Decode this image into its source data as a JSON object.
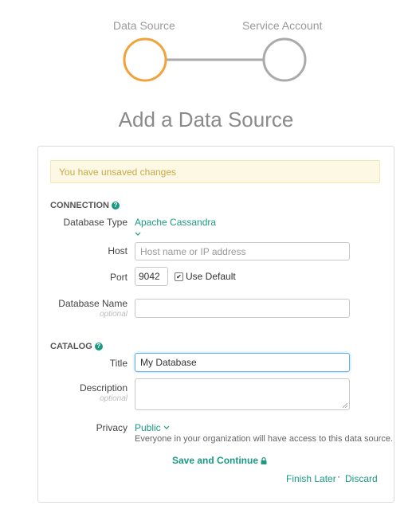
{
  "stepper": {
    "steps": [
      {
        "label": "Data Source",
        "color": "#f0a33a"
      },
      {
        "label": "Service Account",
        "color": "#aaaaaa"
      }
    ]
  },
  "page_title": "Add a Data Source",
  "alert": {
    "text": "You have unsaved changes"
  },
  "connection": {
    "heading": "CONNECTION",
    "database_type": {
      "label": "Database Type",
      "value": "Apache Cassandra"
    },
    "host": {
      "label": "Host",
      "placeholder": "Host name or IP address",
      "value": ""
    },
    "port": {
      "label": "Port",
      "value": "9042",
      "use_default_label": "Use Default",
      "use_default_checked": true
    },
    "database_name": {
      "label": "Database Name",
      "optional": "optional",
      "value": ""
    }
  },
  "catalog": {
    "heading": "CATALOG",
    "title": {
      "label": "Title",
      "value": "My Database"
    },
    "description": {
      "label": "Description",
      "optional": "optional",
      "value": ""
    },
    "privacy": {
      "label": "Privacy",
      "value": "Public",
      "hint": "Everyone in your organization will have access to this data source."
    }
  },
  "actions": {
    "save_continue": "Save and Continue",
    "finish_later": "Finish Later",
    "separator": "·",
    "discard": "Discard"
  },
  "colors": {
    "accent": "#1a9a82",
    "active_step": "#f0a33a",
    "inactive_step": "#aaaaaa",
    "focus": "#66afe9"
  }
}
